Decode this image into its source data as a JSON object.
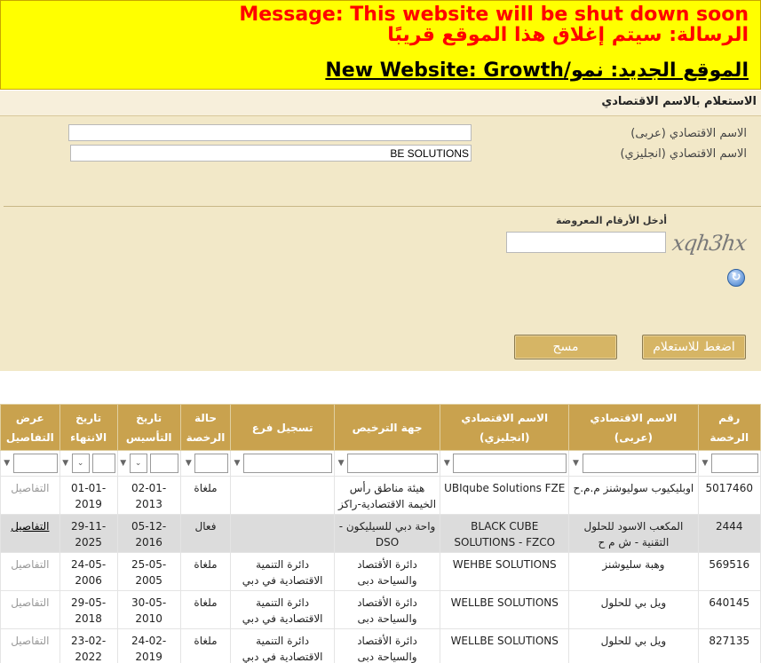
{
  "banner": {
    "line_en": "Message: This website will be shut down soon",
    "line_ar": "الرسالة: سيتم إغلاق هذا الموقع قريبًا",
    "line_new": "الموقع الجديد: نمو/New Website: Growth"
  },
  "panel": {
    "title": "الاستعلام بالاسم الاقتصادي",
    "label_ar": "الاسم الاقتصادي (عربى)",
    "label_en": "الاسم الاقتصادي (انجليزي)",
    "value_ar": "",
    "value_en": "BE SOLUTIONS",
    "captcha_label": "أدخل الأرقام المعروضة",
    "captcha_text": "xqh3hx",
    "search_button": "اضغط للاستعلام",
    "clear_button": "مسح"
  },
  "colors": {
    "banner_bg": "#ffff00",
    "banner_text": "#ff0000",
    "panel_bg": "#f2e8c8",
    "header_bg": "#c9a24e",
    "button_bg": "#d6b565"
  },
  "table": {
    "columns": [
      "رقم الرخصة",
      "الاسم الاقتصادي (عربى)",
      "الاسم الاقتصادي (انجليزي)",
      "جهة الترخيص",
      "تسجيل فرع",
      "حالة الرخصة",
      "تاريخ التأسيس",
      "تاريخ الانتهاء",
      "عرض التفاصيل"
    ],
    "rows": [
      {
        "license": "5017460",
        "name_ar": "اوبليكيوب سوليوشنز م.م.ح",
        "name_en": "UBIqube Solutions FZE",
        "authority": "هيئة مناطق رأس الخيمة الاقتصادية-راكز",
        "branch": "",
        "status": "ملغاة",
        "est": "02-01-2013",
        "exp": "01-01-2019",
        "details": "التفاصيل"
      },
      {
        "license": "2444",
        "name_ar": "المكعب الاسود للحلول التقنية - ش م ح",
        "name_en": "BLACK CUBE SOLUTIONS - FZCO",
        "authority": "واحة دبي للسيليكون - DSO",
        "branch": "",
        "status": "فعال",
        "est": "05-12-2016",
        "exp": "29-11-2025",
        "details": "التفاصيل"
      },
      {
        "license": "569516",
        "name_ar": "وهبة سليوشنز",
        "name_en": "WEHBE SOLUTIONS",
        "authority": "دائرة الأقتصاد والسياحة دبى",
        "branch": "دائرة التنمية الاقتصادية في دبي",
        "status": "ملغاة",
        "est": "25-05-2005",
        "exp": "24-05-2006",
        "details": "التفاصيل"
      },
      {
        "license": "640145",
        "name_ar": "ويل بي للحلول",
        "name_en": "WELLBE SOLUTIONS",
        "authority": "دائرة الأقتصاد والسياحة دبى",
        "branch": "دائرة التنمية الاقتصادية في دبي",
        "status": "ملغاة",
        "est": "30-05-2010",
        "exp": "29-05-2018",
        "details": "التفاصيل"
      },
      {
        "license": "827135",
        "name_ar": "ويل بي للحلول",
        "name_en": "WELLBE SOLUTIONS",
        "authority": "دائرة الأقتصاد والسياحة دبى",
        "branch": "دائرة التنمية الاقتصادية في دبي",
        "status": "ملغاة",
        "est": "24-02-2019",
        "exp": "23-02-2022",
        "details": "التفاصيل"
      }
    ]
  }
}
